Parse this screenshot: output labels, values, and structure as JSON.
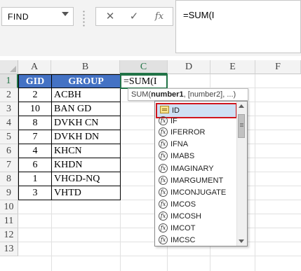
{
  "formula_bar": {
    "name_box": "FIND",
    "cancel_icon": "✕",
    "enter_icon": "✓",
    "insert_function_icon": "fx",
    "formula_text": "=SUM(I"
  },
  "columns": [
    "A",
    "B",
    "C",
    "D",
    "E",
    "F"
  ],
  "rows": [
    "1",
    "2",
    "3",
    "4",
    "5",
    "6",
    "7",
    "8",
    "9",
    "10",
    "11",
    "12",
    "13"
  ],
  "table": {
    "headers": [
      "GID",
      "GROUP"
    ],
    "rows": [
      {
        "gid": "2",
        "group": "ACBH"
      },
      {
        "gid": "10",
        "group": "BAN GD"
      },
      {
        "gid": "8",
        "group": "DVKH CN"
      },
      {
        "gid": "7",
        "group": "DVKH DN"
      },
      {
        "gid": "4",
        "group": "KHCN"
      },
      {
        "gid": "6",
        "group": "KHDN"
      },
      {
        "gid": "1",
        "group": "VHGD-NQ"
      },
      {
        "gid": "3",
        "group": "VHTD"
      }
    ]
  },
  "active_cell": {
    "text": "=SUM(I"
  },
  "tooltip": {
    "fn": "SUM(",
    "arg1": "number1",
    "rest": ", [number2], ...)"
  },
  "autocomplete": {
    "items": [
      {
        "label": "ID",
        "icon": "table-name-icon"
      },
      {
        "label": "IF",
        "icon": "function-icon"
      },
      {
        "label": "IFERROR",
        "icon": "function-icon"
      },
      {
        "label": "IFNA",
        "icon": "function-icon"
      },
      {
        "label": "IMABS",
        "icon": "function-icon"
      },
      {
        "label": "IMAGINARY",
        "icon": "function-icon"
      },
      {
        "label": "IMARGUMENT",
        "icon": "function-icon"
      },
      {
        "label": "IMCONJUGATE",
        "icon": "function-icon"
      },
      {
        "label": "IMCOS",
        "icon": "function-icon"
      },
      {
        "label": "IMCOSH",
        "icon": "function-icon"
      },
      {
        "label": "IMCOT",
        "icon": "function-icon"
      },
      {
        "label": "IMCSC",
        "icon": "function-icon"
      }
    ],
    "selected_index": 0
  },
  "colors": {
    "accent": "#217346",
    "table_header": "#4472c4",
    "selection_highlight": "#cfe0f3",
    "focus_outline": "#d0161c"
  }
}
